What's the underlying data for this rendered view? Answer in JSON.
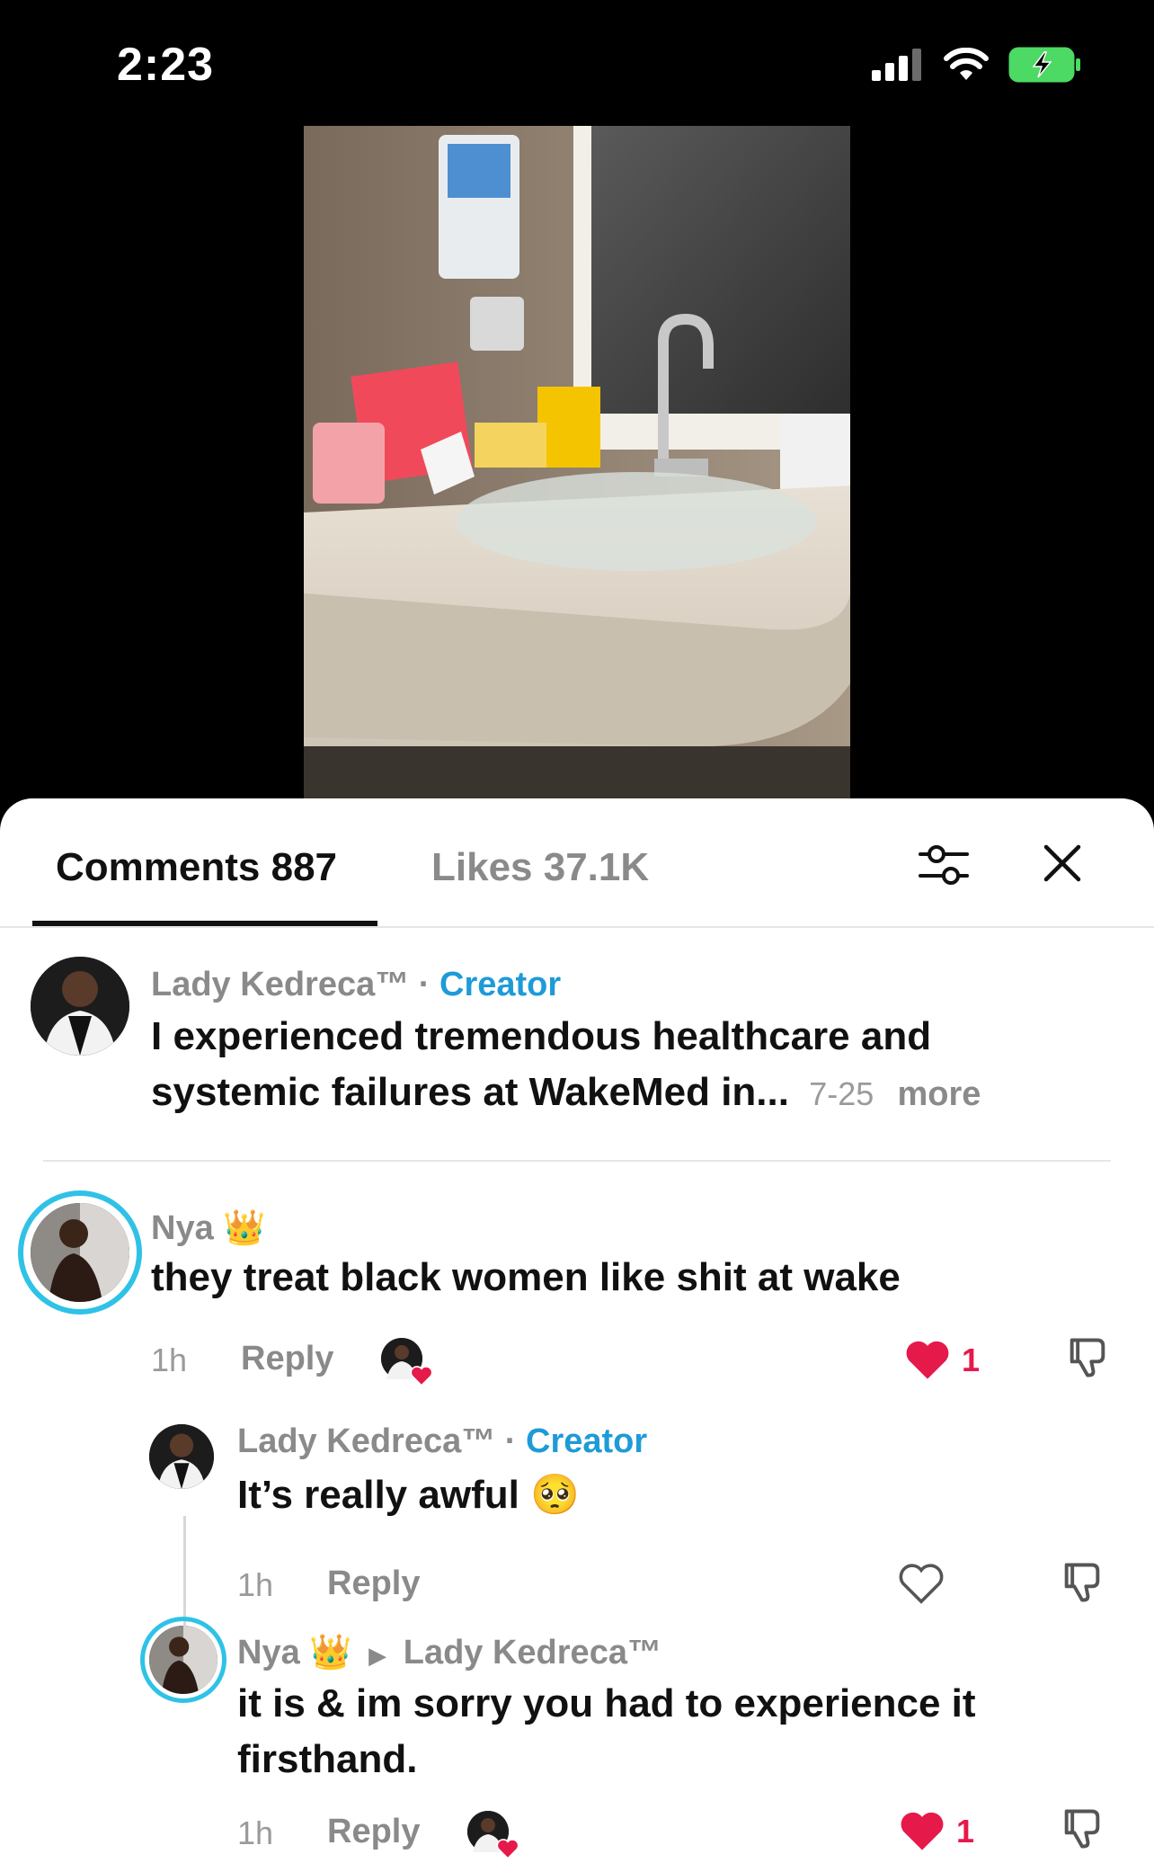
{
  "status": {
    "time": "2:23"
  },
  "tabs": {
    "comments": "Comments 887",
    "likes": "Likes 37.1K"
  },
  "comments": [
    {
      "author": "Lady Kedreca™",
      "badge": "Creator",
      "text_line1": "I experienced tremendous healthcare and",
      "text_line2": "systemic failures at WakeMed in...",
      "date": "7-25",
      "more": "more"
    },
    {
      "author": "Nya",
      "author_emoji": "👑",
      "text": "they treat black women like shit at wake",
      "time": "1h",
      "reply": "Reply",
      "likes": "1"
    },
    {
      "author": "Lady Kedreca™",
      "badge": "Creator",
      "text": "It’s really awful",
      "text_emoji": "🥺",
      "time": "1h",
      "reply": "Reply"
    },
    {
      "author": "Nya",
      "author_emoji": "👑",
      "reply_to": "Lady Kedreca™",
      "text_line1": "it is & im sorry you had to experience it",
      "text_line2": "firsthand.",
      "time": "1h",
      "reply": "Reply",
      "likes": "1"
    }
  ],
  "icons": {
    "filter": "filter-sliders-icon",
    "close": "close-icon",
    "like": "heart-icon",
    "dislike": "thumbs-down-icon"
  },
  "colors": {
    "accent": "#1e9bd7",
    "like": "#e6194b",
    "ring": "#2fc2e6"
  }
}
